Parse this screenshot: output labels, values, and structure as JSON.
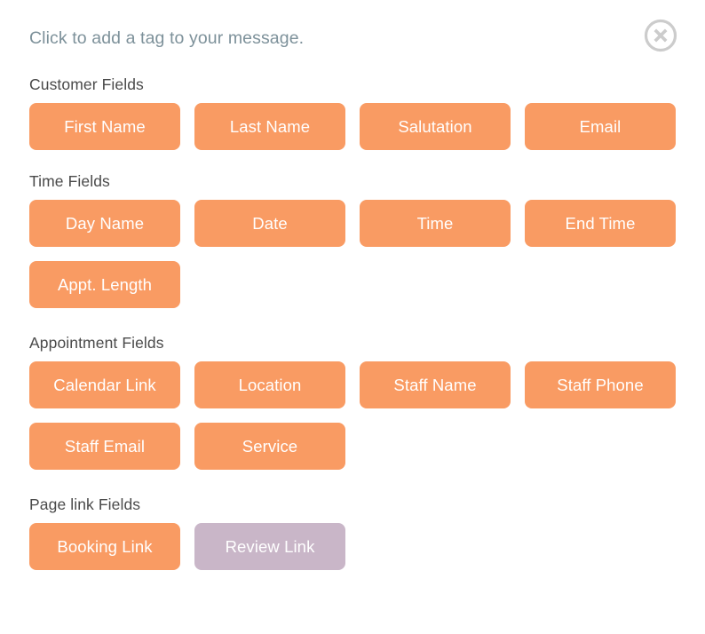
{
  "dialog": {
    "title": "Click to add a tag to your message.",
    "close_label": "Close"
  },
  "colors": {
    "tag_orange": "#f99b63",
    "tag_purple": "#c9b6c8",
    "title_text": "#7d919a",
    "heading_text": "#4a4a4a",
    "close_icon": "#cccccc",
    "background": "#ffffff"
  },
  "sections": [
    {
      "heading": "Customer Fields",
      "tags": [
        {
          "label": "First Name",
          "style": "orange"
        },
        {
          "label": "Last Name",
          "style": "orange"
        },
        {
          "label": "Salutation",
          "style": "orange"
        },
        {
          "label": "Email",
          "style": "orange"
        }
      ]
    },
    {
      "heading": "Time Fields",
      "tags": [
        {
          "label": "Day Name",
          "style": "orange"
        },
        {
          "label": "Date",
          "style": "orange"
        },
        {
          "label": "Time",
          "style": "orange"
        },
        {
          "label": "End Time",
          "style": "orange"
        },
        {
          "label": "Appt. Length",
          "style": "orange"
        }
      ]
    },
    {
      "heading": "Appointment Fields",
      "tags": [
        {
          "label": "Calendar Link",
          "style": "orange"
        },
        {
          "label": "Location",
          "style": "orange"
        },
        {
          "label": "Staff Name",
          "style": "orange"
        },
        {
          "label": "Staff Phone",
          "style": "orange"
        },
        {
          "label": "Staff Email",
          "style": "orange"
        },
        {
          "label": "Service",
          "style": "orange"
        }
      ]
    },
    {
      "heading": "Page link Fields",
      "tags": [
        {
          "label": "Booking Link",
          "style": "orange"
        },
        {
          "label": "Review Link",
          "style": "purple"
        }
      ]
    }
  ]
}
